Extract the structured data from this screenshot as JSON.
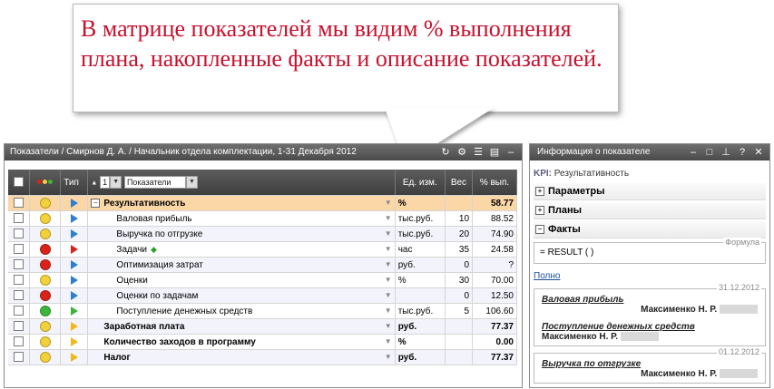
{
  "callout": {
    "text": "В матрице показателей мы видим % выполнения плана, накопленные факты и описание показателей."
  },
  "left_panel": {
    "title": "Показатели / Смирнов Д. А. / Начальник отдела комплектации, 1-31 Декабря 2012",
    "icons": [
      "refresh-icon",
      "gear-icon",
      "list-icon",
      "export-icon",
      "minimize-icon"
    ],
    "columns": {
      "type": "Тип",
      "level_value": "1",
      "level_label": "Показатели",
      "unit": "Ед. изм.",
      "weight": "Вес",
      "pct": "% вып."
    },
    "rows": [
      {
        "status": "#f2d13a",
        "tri": "#2f7fd1",
        "name": "Результативность",
        "bold": true,
        "expand": "−",
        "indent": 0,
        "unit": "%",
        "weight": "",
        "pct": "58.77",
        "selected": true
      },
      {
        "status": "#f2d13a",
        "tri": "#2f7fd1",
        "name": "Валовая прибыль",
        "bold": false,
        "expand": "",
        "indent": 2,
        "unit": "тыс.руб.",
        "weight": "10",
        "pct": "88.52"
      },
      {
        "status": "#f2d13a",
        "tri": "#2f7fd1",
        "name": "Выручка по отгрузке",
        "bold": false,
        "expand": "",
        "indent": 2,
        "unit": "тыс.руб.",
        "weight": "20",
        "pct": "74.90"
      },
      {
        "status": "#d9231a",
        "tri": "#d9231a",
        "name": "Задачи",
        "bold": false,
        "expand": "",
        "indent": 2,
        "unit": "час",
        "weight": "35",
        "pct": "24.58",
        "diamond": true
      },
      {
        "status": "#d9231a",
        "tri": "#2f7fd1",
        "name": "Оптимизация затрат",
        "bold": false,
        "expand": "",
        "indent": 2,
        "unit": "руб.",
        "weight": "0",
        "pct": "?"
      },
      {
        "status": "#f2d13a",
        "tri": "#2f7fd1",
        "name": "Оценки",
        "bold": false,
        "expand": "",
        "indent": 2,
        "unit": "%",
        "weight": "30",
        "pct": "70.00"
      },
      {
        "status": "#d9231a",
        "tri": "#2f7fd1",
        "name": "Оценки по задачам",
        "bold": false,
        "expand": "",
        "indent": 2,
        "unit": "",
        "weight": "0",
        "pct": "12.50"
      },
      {
        "status": "#3db43a",
        "tri": "#3db43a",
        "name": "Поступление денежных средств",
        "bold": false,
        "expand": "",
        "indent": 2,
        "unit": "тыс.руб.",
        "weight": "5",
        "pct": "106.60"
      },
      {
        "status": "#f2d13a",
        "tri": "#f2b81a",
        "name": "Заработная плата",
        "bold": true,
        "expand": "",
        "indent": 1,
        "unit": "руб.",
        "weight": "",
        "pct": "77.37"
      },
      {
        "status": "#f2d13a",
        "tri": "#f2b81a",
        "name": "Количество заходов в программу",
        "bold": true,
        "expand": "",
        "indent": 1,
        "unit": "%",
        "weight": "",
        "pct": "0.00"
      },
      {
        "status": "#f2d13a",
        "tri": "#f2b81a",
        "name": "Налог",
        "bold": true,
        "expand": "",
        "indent": 1,
        "unit": "руб.",
        "weight": "",
        "pct": "77.37"
      }
    ]
  },
  "right_panel": {
    "title": "Информация о показателе",
    "kpi_prefix": "KPI:",
    "kpi_name": "Результативность",
    "sections": {
      "params": "Параметры",
      "plans": "Планы",
      "facts": "Факты"
    },
    "formula_legend": "Формула",
    "formula": "= RESULT ( )",
    "full_link": "Полно",
    "fact_groups": [
      {
        "date": "31.12.2012",
        "items": [
          {
            "name": "Валовая прибыль",
            "person": "Максименко Н. Р."
          },
          {
            "name": "Поступление денежных средств",
            "person": "Максименко Н. Р."
          }
        ]
      },
      {
        "date": "01.12.2012",
        "items": [
          {
            "name": "Выручка по отгрузке",
            "person": "Максименко Н. Р."
          }
        ]
      }
    ]
  }
}
